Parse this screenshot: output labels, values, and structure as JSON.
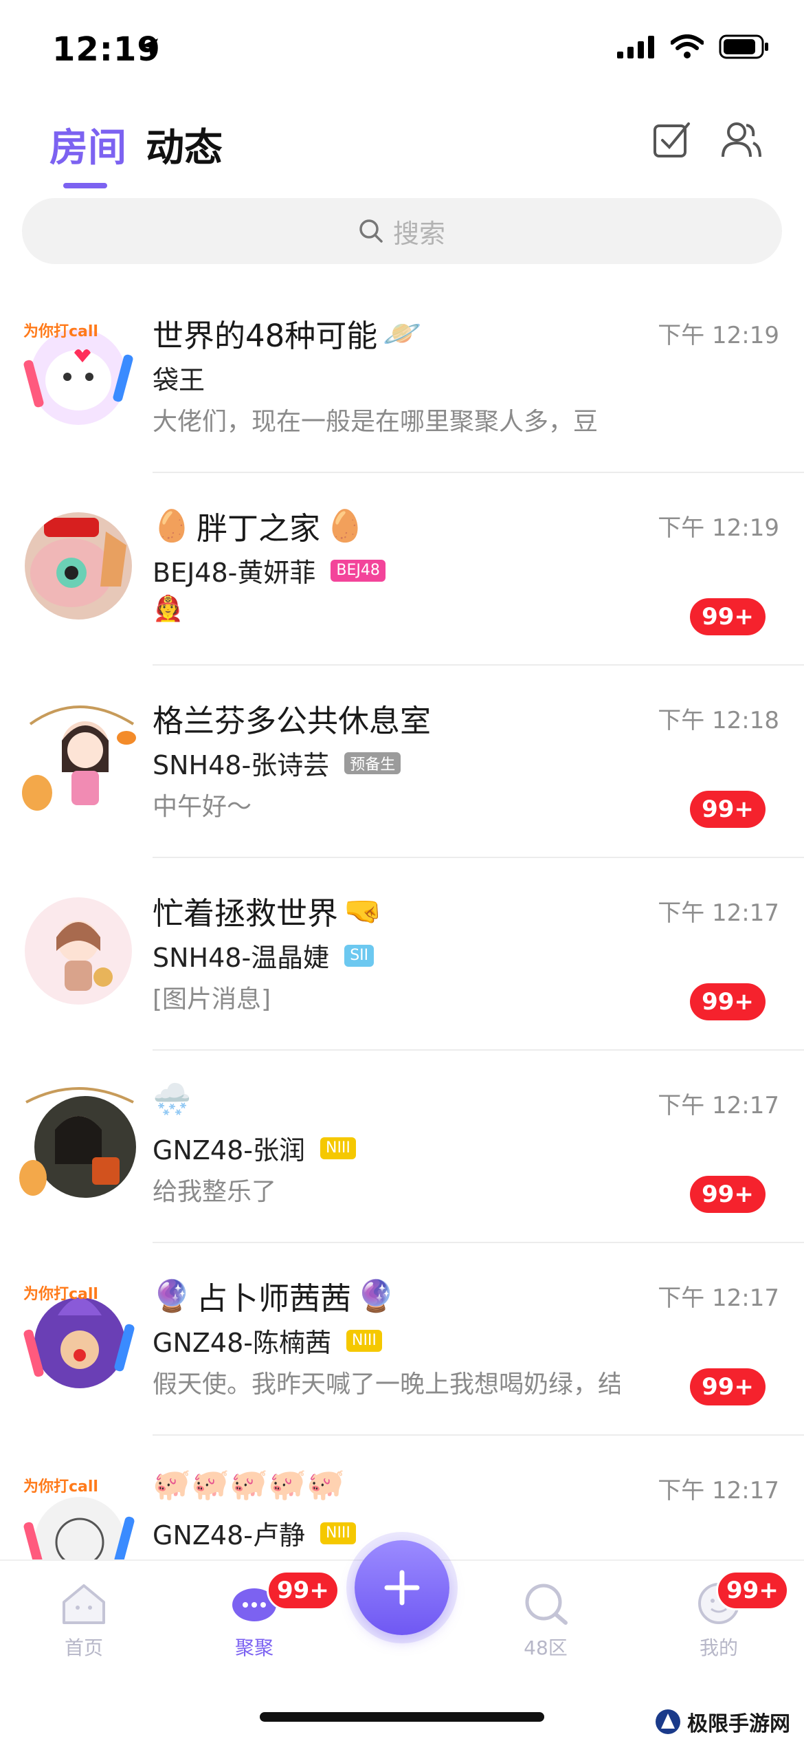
{
  "status_bar": {
    "time": "12:19"
  },
  "header": {
    "tabs": [
      {
        "label": "房间",
        "active": true
      },
      {
        "label": "动态",
        "active": false
      }
    ],
    "accent_color": "#7c62f1"
  },
  "search": {
    "placeholder": "搜索"
  },
  "rooms": [
    {
      "title": "世界的48种可能",
      "title_emoji": "🪐",
      "time": "下午 12:19",
      "sender": "袋王",
      "tag": "",
      "message": "大佬们，现在一般是在哪里聚聚人多，豆",
      "badge": ""
    },
    {
      "title": "胖丁之家",
      "title_emoji": "🥚",
      "time": "下午 12:19",
      "sender": "BEJ48-黄妍菲",
      "tag": "BEJ48",
      "message": "🧑‍🚒",
      "badge": "99+"
    },
    {
      "title": "格兰芬多公共休息室",
      "title_emoji": "",
      "time": "下午 12:18",
      "sender": "SNH48-张诗芸",
      "tag": "预备生",
      "message": "中午好～",
      "badge": "99+"
    },
    {
      "title": "忙着拯救世界",
      "title_emoji": "🤜",
      "time": "下午 12:17",
      "sender": "SNH48-温晶婕",
      "tag": "SII",
      "message": "[图片消息]",
      "badge": "99+"
    },
    {
      "title": "🌨️",
      "title_emoji": "",
      "time": "下午 12:17",
      "sender": "GNZ48-张润",
      "tag": "NIII",
      "message": "给我整乐了",
      "badge": "99+"
    },
    {
      "title": "占卜师茜茜",
      "title_emoji": "🔮",
      "time": "下午 12:17",
      "sender": "GNZ48-陈楠茜",
      "tag": "NIII",
      "message": "假天使。我昨天喊了一晚上我想喝奶绿，结",
      "badge": "99+"
    },
    {
      "title": "🐖🐖🐖🐖🐖",
      "title_emoji": "",
      "time": "下午 12:17",
      "sender": "GNZ48-卢静",
      "tag": "NIII",
      "message": "",
      "badge": ""
    }
  ],
  "tabbar": {
    "items": [
      {
        "label": "首页",
        "icon": "home-icon",
        "active": false
      },
      {
        "label": "聚聚",
        "icon": "chat-bubble-icon",
        "active": true,
        "badge": "99+"
      },
      {
        "label": "48区",
        "icon": "search-icon",
        "active": false
      },
      {
        "label": "我的",
        "icon": "profile-icon",
        "active": false,
        "badge": "99+"
      }
    ]
  },
  "watermark": {
    "text": "极限手游网"
  }
}
